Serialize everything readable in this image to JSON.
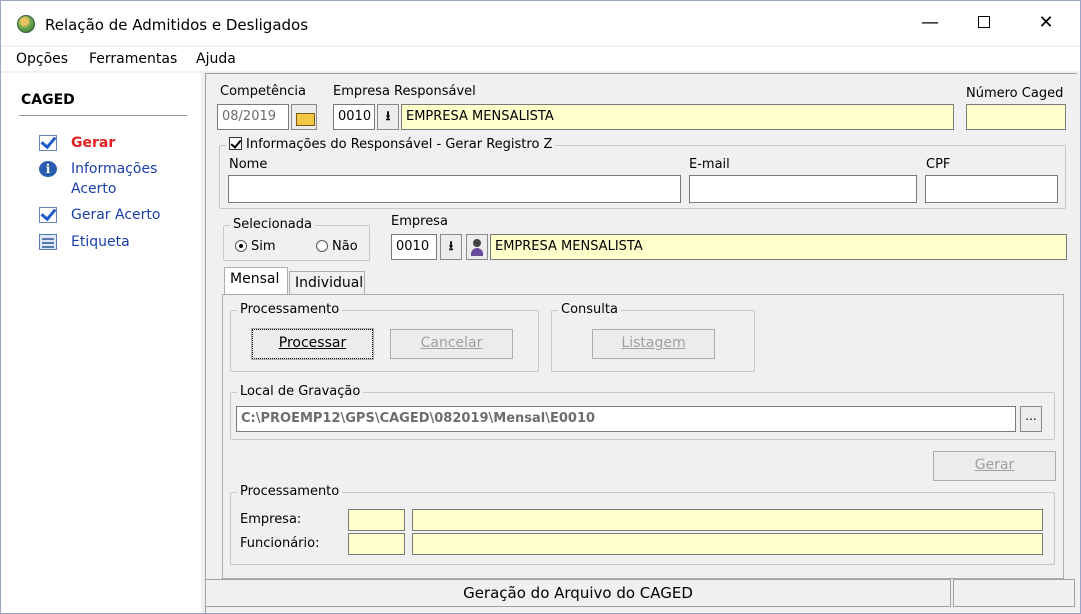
{
  "window": {
    "title": "Relação de Admitidos e Desligados",
    "minimize": "—",
    "close": "✕"
  },
  "menu": [
    "Opções",
    "Ferramentas",
    "Ajuda"
  ],
  "sidebar": {
    "title": "CAGED",
    "items": [
      {
        "label": "Gerar",
        "icon": "check-icon",
        "active": true
      },
      {
        "label": "Informações",
        "label2": "Acerto",
        "icon": "info-icon"
      },
      {
        "label": "Gerar Acerto",
        "icon": "check-icon"
      },
      {
        "label": "Etiqueta",
        "icon": "label-icon"
      }
    ]
  },
  "form": {
    "competencia_label": "Competência",
    "competencia_value": "08/2019",
    "empresa_resp_label": "Empresa Responsável",
    "empresa_resp_code": "0010",
    "empresa_resp_name": "EMPRESA MENSALISTA",
    "numero_caged_label": "Número Caged",
    "numero_caged_value": "",
    "responsavel_group": "Informações do Responsável - Gerar Registro Z",
    "nome_label": "Nome",
    "email_label": "E-mail",
    "cpf_label": "CPF",
    "selecionada_group": "Selecionada",
    "sim_label": "Sim",
    "nao_label": "Não",
    "empresa_label": "Empresa",
    "empresa_code": "0010",
    "empresa_name": "EMPRESA MENSALISTA",
    "dropdown_glyph": "⭳"
  },
  "tabs": [
    "Mensal",
    "Individual"
  ],
  "mensal": {
    "processamento_group": "Processamento",
    "processar_label": "Processar",
    "cancelar_label": "Cancelar",
    "consulta_group": "Consulta",
    "listagem_label": "Listagem",
    "local_group": "Local de Gravação",
    "local_path": "C:\\PROEMP12\\GPS\\CAGED\\082019\\Mensal\\E0010",
    "browse_label": "...",
    "gerar_label": "Gerar",
    "processamento2_group": "Processamento",
    "empresa_label": "Empresa:",
    "funcionario_label": "Funcionário:"
  },
  "status": {
    "message": "Geração do Arquivo do CAGED"
  }
}
